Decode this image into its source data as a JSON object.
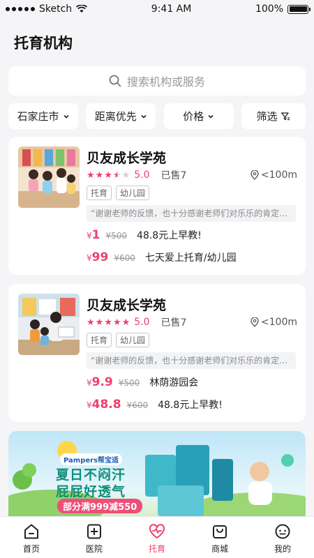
{
  "status": {
    "carrier": "Sketch",
    "time": "9:41 AM",
    "battery": "100%"
  },
  "title": "托育机构",
  "search": {
    "placeholder": "搜索机构或服务"
  },
  "filters": [
    {
      "label": "石家庄市",
      "icon": "chevron-down-icon"
    },
    {
      "label": "距离优先",
      "icon": "chevron-down-icon"
    },
    {
      "label": "价格",
      "icon": "chevron-down-icon"
    },
    {
      "label": "筛选",
      "icon": "filter-icon"
    }
  ],
  "cards": [
    {
      "name": "贝友成长学苑",
      "rating": 3.5,
      "score": "5.0",
      "sold": "已售7",
      "distance": "<100m",
      "tags": [
        "托育",
        "幼儿园"
      ],
      "review": "“谢谢老师的反馈，也十分感谢老师们对乐乐的肯定…",
      "deals": [
        {
          "price": "1",
          "original": "¥500",
          "desc": "48.8元上早教!"
        },
        {
          "price": "99",
          "original": "¥600",
          "desc": "七天爱上托育/幼儿园"
        }
      ]
    },
    {
      "name": "贝友成长学苑",
      "rating": 5,
      "score": "5.0",
      "sold": "已售7",
      "distance": "<100m",
      "tags": [
        "托育",
        "幼儿园"
      ],
      "review": "“谢谢老师的反馈，也十分感谢老师们对乐乐的肯定…",
      "deals": [
        {
          "price": "9.9",
          "original": "¥500",
          "desc": "林荫游园会"
        },
        {
          "price": "48.8",
          "original": "¥600",
          "desc": "48.8元上早教!"
        }
      ]
    }
  ],
  "banner": {
    "brand": "Pampers帮宝适",
    "line1": "夏日不闷汗",
    "line2": "屁屁好透气",
    "promo": "部分满999减550"
  },
  "tabs": [
    {
      "label": "首页",
      "icon": "home-icon",
      "active": false
    },
    {
      "label": "医院",
      "icon": "hospital-icon",
      "active": false
    },
    {
      "label": "托育",
      "icon": "heart-pulse-icon",
      "active": true
    },
    {
      "label": "商城",
      "icon": "shopping-bag-icon",
      "active": false
    },
    {
      "label": "我的",
      "icon": "profile-icon",
      "active": false
    }
  ],
  "colors": {
    "accent": "#ee3f6b",
    "background": "#f5f5f7"
  },
  "currency": "¥"
}
